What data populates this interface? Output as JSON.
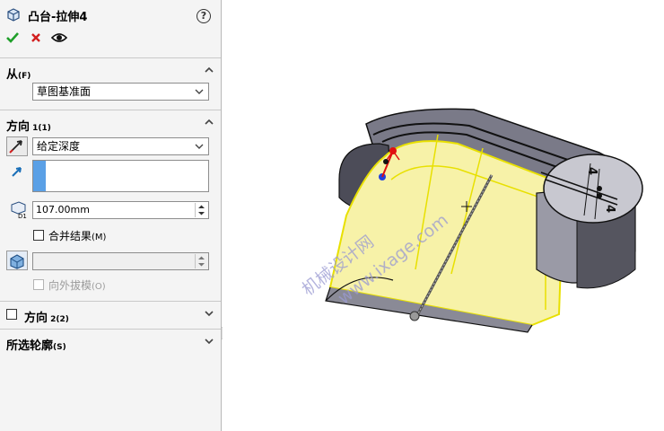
{
  "title": "凸台-拉伸4",
  "help_label": "?",
  "section_from": {
    "label": "从",
    "shortcut": "(F)",
    "value": "草图基准面"
  },
  "direction1": {
    "label": "方向",
    "number": " 1",
    "shortcut": "(1)",
    "end_condition": "给定深度",
    "depth": "107.00mm"
  },
  "merge_result": {
    "label": "合并结果",
    "shortcut": "(M)",
    "checked": true
  },
  "draft_outward": {
    "label": "向外拔模",
    "shortcut": "(O)",
    "checked": false
  },
  "direction2": {
    "label": "方向",
    "number": " 2",
    "shortcut": "(2)",
    "checked": false
  },
  "selected_contours": {
    "label": "所选轮廓",
    "shortcut": "(S)"
  },
  "viewport": {
    "watermark_line1": "机械设计网",
    "watermark_line2": "www.ixage.com",
    "dim_a": "4",
    "dim_b": "4"
  },
  "colors": {
    "accent_blue": "#5aa0e6",
    "ok_green": "#1f9f2a",
    "cancel_red": "#d21e1e",
    "face_yellow": "#f7f2a8",
    "edge_yellow": "#e8e000"
  }
}
